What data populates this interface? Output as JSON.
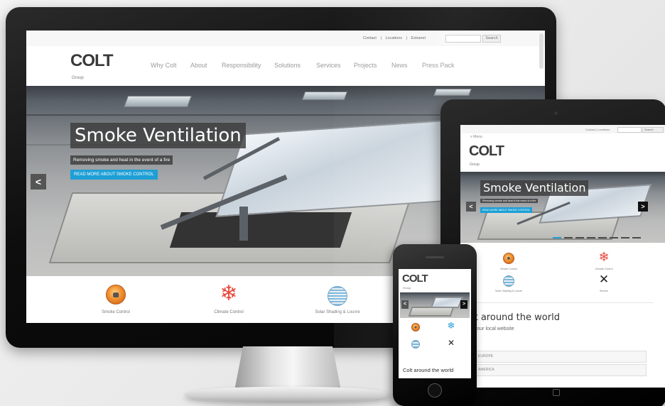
{
  "desktop": {
    "utility": {
      "contact": "Contact",
      "locations": "Locations",
      "extranet": "Extranet",
      "separator": "|",
      "search_button": "Search"
    },
    "logo": {
      "word": "COLT",
      "sub": "Group"
    },
    "nav": [
      "Why Colt",
      "About",
      "Responsibility",
      "Solutions",
      "Services",
      "Projects",
      "News",
      "Press Pack"
    ],
    "hero": {
      "title": "Smoke Ventilation",
      "subtitle": "Removing smoke and heat in the event of a fire",
      "button": "READ MORE ABOUT SMOKE CONTROL",
      "prev_arrow": "<"
    },
    "features": [
      {
        "label": "Smoke Control",
        "icon": "fire-icon"
      },
      {
        "label": "Climate Control",
        "icon": "snowflake-sun-icon"
      },
      {
        "label": "Solar Shading & Louvre",
        "icon": "louvre-sun-icon"
      }
    ]
  },
  "tablet": {
    "menu": "≡ Menu",
    "utility": {
      "contact": "Contact",
      "locations": "Locations",
      "separator": "|",
      "search_button": "Search"
    },
    "logo": {
      "word": "COLT",
      "sub": "Group"
    },
    "hero": {
      "title": "Smoke Ventilation",
      "subtitle": "Removing smoke and heat in the event of a fire",
      "button": "READ MORE ABOUT SMOKE CONTROL",
      "prev_arrow": "<",
      "next_arrow": ">"
    },
    "features": [
      {
        "label": "Smoke Control",
        "icon": "fire-icon"
      },
      {
        "label": "Climate Control",
        "icon": "snowflake-sun-icon"
      },
      {
        "label": "Solar Shading & Louvre",
        "icon": "louvre-sun-icon"
      },
      {
        "label": "Service",
        "icon": "tools-icon"
      }
    ],
    "world_heading": "lt around the world",
    "world_sub": "t your local website",
    "regions": [
      "EUROPE",
      "AMERICA"
    ]
  },
  "phone": {
    "logo": {
      "word": "COLT",
      "sub": "Group"
    },
    "prev_arrow": "<",
    "next_arrow": ">",
    "world_heading": "Colt around the world"
  },
  "colors": {
    "accent_blue": "#1d9fd6",
    "fire_orange": "#f0902c",
    "snow_red": "#e8483b",
    "snow_blue": "#2a9fd6"
  }
}
